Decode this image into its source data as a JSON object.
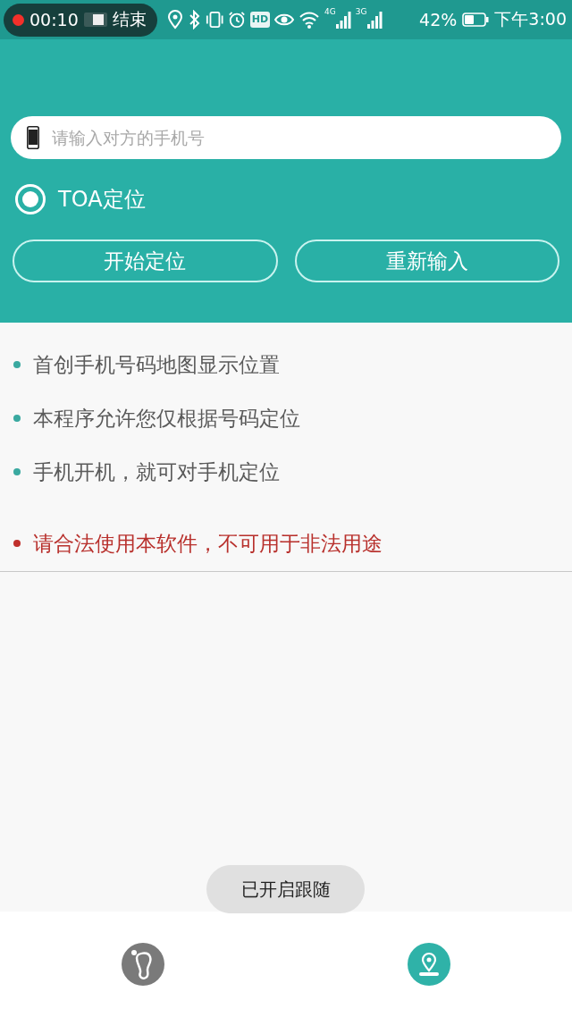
{
  "status_bar": {
    "recording": {
      "time": "00:10",
      "stop_label": "结束"
    },
    "network_labels": [
      "4G",
      "3G"
    ],
    "hd_label": "HD",
    "battery": "42%",
    "time": "下午3:00"
  },
  "phone_input": {
    "placeholder": "请输入对方的手机号"
  },
  "radio_options": [
    {
      "label": "TOA定位",
      "selected": true
    }
  ],
  "buttons": [
    "开始定位",
    "重新输入"
  ],
  "notes": [
    {
      "kind": "note",
      "color": "#3aa9a0",
      "text": "首创手机号码地图显示位置"
    },
    {
      "kind": "note",
      "color": "#3aa9a0",
      "text": "本程序允许您仅根据号码定位"
    },
    {
      "kind": "note",
      "color": "#3aa9a0",
      "text": "手机开机，就可对手机定位"
    },
    {
      "kind": "warning",
      "color": "#c0302c",
      "text": "请合法使用本软件，不可用于非法用途"
    }
  ],
  "toast": "已开启跟随",
  "bottom_nav": [
    {
      "kind": "footprint",
      "selected": false
    },
    {
      "kind": "location",
      "selected": true
    }
  ]
}
